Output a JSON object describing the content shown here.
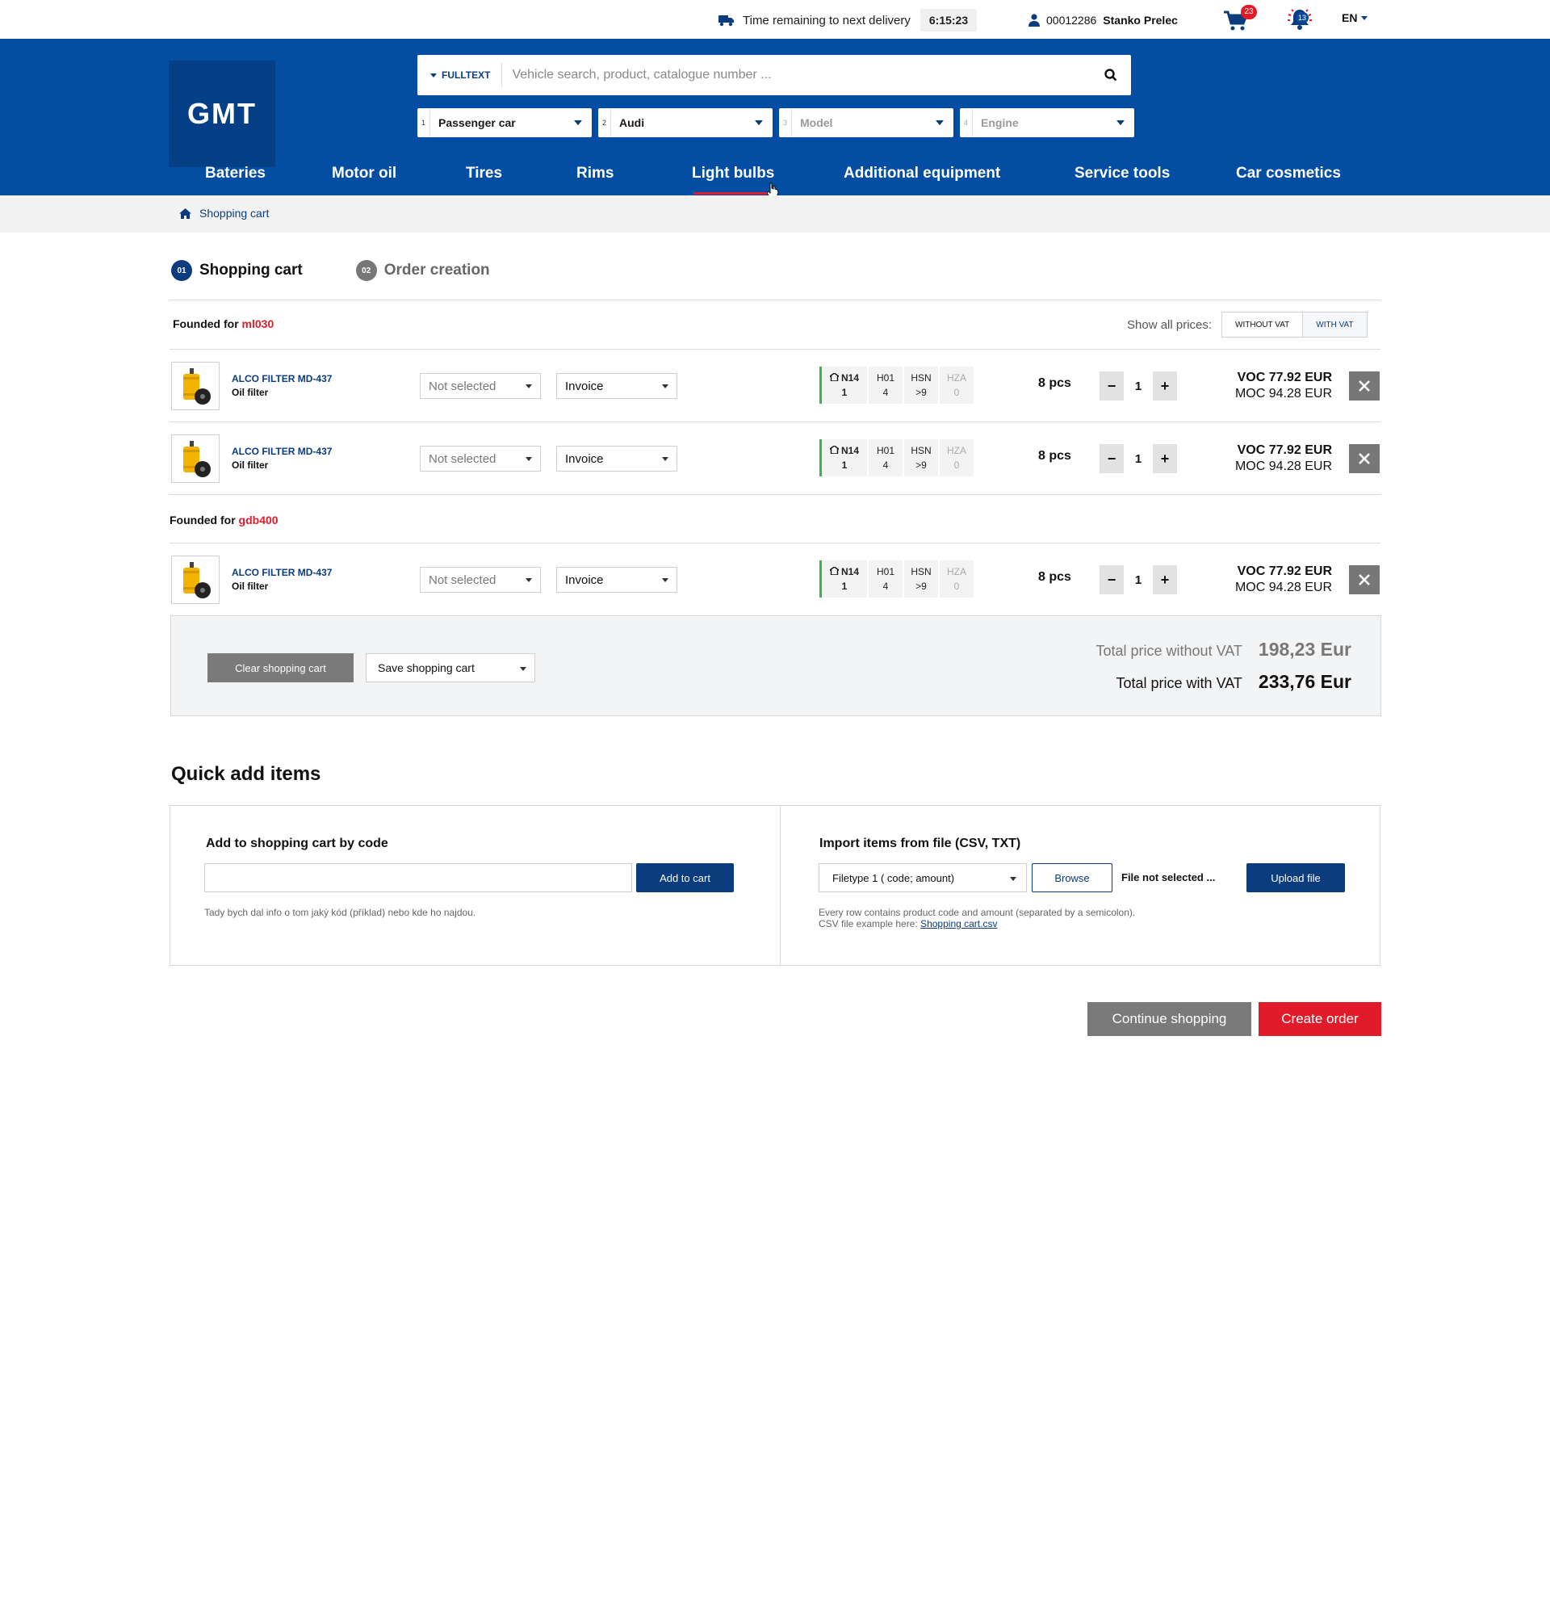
{
  "topbar": {
    "delivery_label": "Time remaining to next delivery",
    "delivery_time": "6:15:23",
    "user_id": "00012286",
    "user_name": "Stanko Prelec",
    "cart_count": "23",
    "notifications_count": "13",
    "language": "EN"
  },
  "header": {
    "logo_text": "GMT",
    "search_mode": "FULLTEXT",
    "search_placeholder": "Vehicle search, product, catalogue number ...",
    "selectors": [
      {
        "num": "1",
        "value": "Passenger car"
      },
      {
        "num": "2",
        "value": "Audi"
      },
      {
        "num": "3",
        "value": "Model"
      },
      {
        "num": "4",
        "value": "Engine"
      }
    ],
    "nav": [
      "Bateries",
      "Motor oil",
      "Tires",
      "Rims",
      "Light bulbs",
      "Additional equipment",
      "Service tools",
      "Car cosmetics"
    ],
    "nav_active": "Light bulbs"
  },
  "breadcrumb": {
    "current": "Shopping cart"
  },
  "steps": [
    {
      "num": "01",
      "label": "Shopping cart",
      "active": true
    },
    {
      "num": "02",
      "label": "Order creation",
      "active": false
    }
  ],
  "price_toggle": {
    "label": "Show all prices:",
    "without": "WITHOUT VAT",
    "with": "WITH VAT",
    "selected": "WITH VAT"
  },
  "groups": [
    {
      "prefix": "Founded for",
      "code": "ml030",
      "items": [
        {
          "name": "ALCO FILTER MD-437",
          "type": "Oil filter",
          "delivery": "Not selected",
          "payment": "Invoice",
          "stock": [
            {
              "label": "N14",
              "value": "1"
            },
            {
              "label": "H01",
              "value": "4"
            },
            {
              "label": "HSN",
              "value": ">9"
            },
            {
              "label": "HZA",
              "value": "0"
            }
          ],
          "pcs": "8 pcs",
          "qty": "1",
          "voc": "VOC 77.92 EUR",
          "moc": "MOC 94.28 EUR"
        },
        {
          "name": "ALCO FILTER MD-437",
          "type": "Oil filter",
          "delivery": "Not selected",
          "payment": "Invoice",
          "stock": [
            {
              "label": "N14",
              "value": "1"
            },
            {
              "label": "H01",
              "value": "4"
            },
            {
              "label": "HSN",
              "value": ">9"
            },
            {
              "label": "HZA",
              "value": "0"
            }
          ],
          "pcs": "8 pcs",
          "qty": "1",
          "voc": "VOC 77.92 EUR",
          "moc": "MOC 94.28 EUR"
        }
      ]
    },
    {
      "prefix": "Founded for",
      "code": "gdb400",
      "items": [
        {
          "name": "ALCO FILTER MD-437",
          "type": "Oil filter",
          "delivery": "Not selected",
          "payment": "Invoice",
          "stock": [
            {
              "label": "N14",
              "value": "1"
            },
            {
              "label": "H01",
              "value": "4"
            },
            {
              "label": "HSN",
              "value": ">9"
            },
            {
              "label": "HZA",
              "value": "0"
            }
          ],
          "pcs": "8 pcs",
          "qty": "1",
          "voc": "VOC 77.92 EUR",
          "moc": "MOC 94.28 EUR"
        }
      ]
    }
  ],
  "totals": {
    "clear_label": "Clear shopping cart",
    "save_label": "Save shopping cart",
    "without_vat_label": "Total price without VAT",
    "without_vat_value": "198,23 Eur",
    "with_vat_label": "Total price with VAT",
    "with_vat_value": "233,76 Eur"
  },
  "quick_add": {
    "title": "Quick add items",
    "by_code_title": "Add to shopping cart by code",
    "add_button": "Add to cart",
    "by_code_note": "Tady bych dal info o tom jaký kód (příklad) nebo kde ho najdou.",
    "import_title": "Import items from file (CSV, TXT)",
    "filetype": "Filetype 1 ( code; amount)",
    "browse": "Browse",
    "file_status": "File not selected ...",
    "upload": "Upload file",
    "import_note_1": "Every row contains product code and amount (separated by a semicolon).",
    "import_note_2": "CSV file example here:",
    "import_link": "Shopping cart.csv"
  },
  "actions": {
    "continue": "Continue shopping",
    "create": "Create order"
  },
  "colors": {
    "brand_blue": "#034da2",
    "dark_blue": "#0b3c7d",
    "accent_red": "#e21b2a",
    "stock_green": "#3db54a"
  }
}
